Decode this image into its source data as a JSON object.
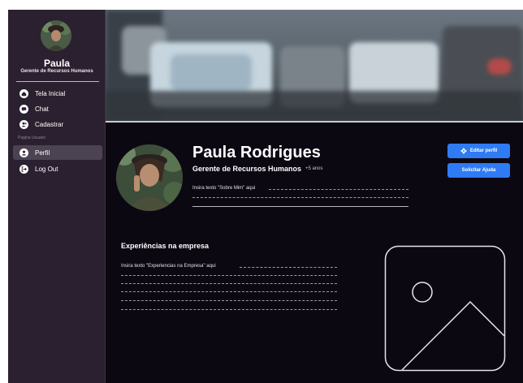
{
  "sidebar": {
    "user_name": "Paula",
    "user_role": "Gerente de Recursos Humanos",
    "nav": [
      {
        "label": "Tela Inicial",
        "icon": "home-icon"
      },
      {
        "label": "Chat",
        "icon": "chat-icon"
      },
      {
        "label": "Cadastrar",
        "icon": "add-user-icon"
      }
    ],
    "section_label": "Pagina Usuario",
    "user_nav": [
      {
        "label": "Perfil",
        "icon": "profile-icon",
        "active": true
      },
      {
        "label": "Log Out",
        "icon": "logout-icon"
      }
    ]
  },
  "profile": {
    "full_name": "Paula Rodrigues",
    "job_title": "Gerente de Recursos Humanos",
    "tenure": "+5 anos",
    "about_placeholder": "Insira texto \"Sobre Mim\" aqui",
    "edit_button": "Editar perfil",
    "help_button": "Solicitar Ajuda"
  },
  "experience": {
    "title": "Experiências na empresa",
    "placeholder": "Insira texto \"Experiencias na Empresa\" aqui"
  },
  "colors": {
    "background": "#0c0812",
    "sidebar": "#2b202f",
    "accent": "#2f7bf4"
  }
}
